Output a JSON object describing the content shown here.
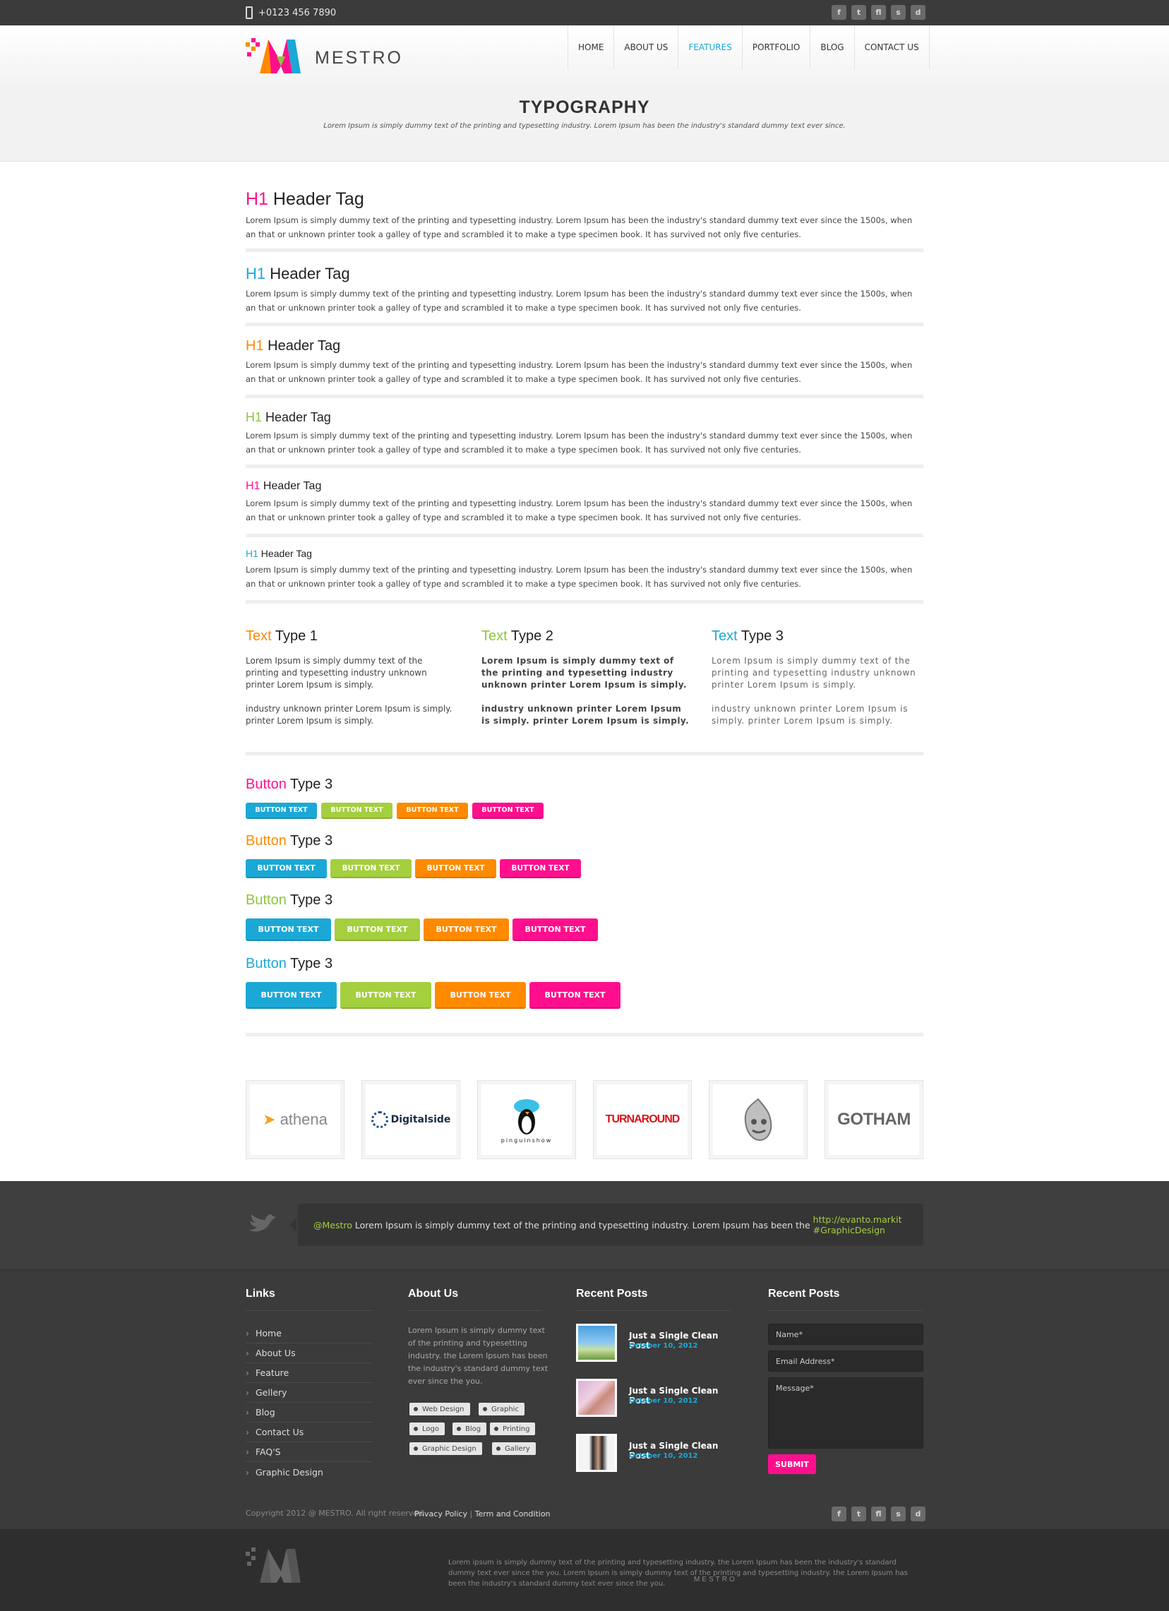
{
  "topbar": {
    "phone": "+0123 456 7890",
    "social": [
      "f",
      "t",
      "fl",
      "s",
      "d"
    ]
  },
  "logo": {
    "text": "MESTRO"
  },
  "nav": [
    "HOME",
    "ABOUT US",
    "FEATURES",
    "PORTFOLIO",
    "BLOG",
    "CONTACT US"
  ],
  "page": {
    "title": "TYPOGRAPHY",
    "subtitle": "Lorem Ipsum is simply dummy text of the printing and typesetting industry. Lorem Ipsum has been the industry's standard dummy text ever since."
  },
  "headers": [
    {
      "tag": "H1",
      "label": "Header Tag",
      "color": "#ff0f8e"
    },
    {
      "tag": "H1",
      "label": "Header Tag",
      "color": "#1ba8d6"
    },
    {
      "tag": "H1",
      "label": "Header Tag",
      "color": "#ff8a00"
    },
    {
      "tag": "H1",
      "label": "Header Tag",
      "color": "#8cc63e"
    },
    {
      "tag": "H1",
      "label": "Header Tag",
      "color": "#ff0f8e"
    },
    {
      "tag": "H1",
      "label": "Header Tag",
      "color": "#1ba8d6"
    }
  ],
  "header_paragraph": "Lorem Ipsum is simply dummy text of the printing and typesetting industry. Lorem Ipsum has been the industry's standard dummy text ever since the 1500s, when an that or unknown printer took a galley of type and scrambled it to make a type specimen book. It has survived not only five centuries.",
  "text_types": [
    {
      "accent": "Text",
      "label": "Type 1",
      "color": "#ff8a00",
      "p1": "Lorem Ipsum is simply dummy text of the printing and typesetting industry unknown printer Lorem Ipsum is simply.",
      "p2": "industry unknown printer Lorem Ipsum is simply. printer Lorem Ipsum is simply."
    },
    {
      "accent": "Text",
      "label": "Type 2",
      "color": "#8cc63e",
      "p1": "Lorem Ipsum is simply dummy text of the printing and typesetting industry unknown printer Lorem Ipsum is simply.",
      "p2": "industry unknown printer Lorem Ipsum is simply. printer Lorem Ipsum is simply."
    },
    {
      "accent": "Text",
      "label": "Type 3",
      "color": "#1ba8d6",
      "p1": "Lorem Ipsum is simply dummy text of the printing and typesetting industry unknown printer Lorem Ipsum is simply.",
      "p2": "industry unknown printer Lorem Ipsum is simply. printer Lorem Ipsum is simply."
    }
  ],
  "button_groups": [
    {
      "accent": "Button",
      "label": "Type 3",
      "color": "#ff0f8e"
    },
    {
      "accent": "Button",
      "label": "Type 3",
      "color": "#ff8a00"
    },
    {
      "accent": "Button",
      "label": "Type 3",
      "color": "#8cc63e"
    },
    {
      "accent": "Button",
      "label": "Type 3",
      "color": "#1ba8d6"
    }
  ],
  "button_text": "BUTTON TEXT",
  "button_colors": [
    "#1ba8d6",
    "#a4cf3e",
    "#ff8a00",
    "#ff0f8e"
  ],
  "partners": [
    "athena",
    "Digitalside",
    "pinguinshow",
    "TURNAROUND",
    "",
    "GOTHAM"
  ],
  "tweet": {
    "handle": "@Mestro",
    "text": " Lorem Ipsum is simply dummy text of the printing and typesetting industry. Lorem Ipsum has been the ",
    "link": "http://evanto.markit #GraphicDesign"
  },
  "footer": {
    "links_title": "Links",
    "links": [
      "Home",
      "About Us",
      "Feature",
      "Gellery",
      "Blog",
      "Contact Us",
      "FAQ'S",
      "Graphic Design"
    ],
    "about_title": "About Us",
    "about_text": "Lorem Ipsum is simply dummy text of the printing and typesetting industry. the Lorem Ipsum has been the industry's standard dummy text ever since the you.",
    "tags": [
      "Web Design",
      "Graphic",
      "Logo",
      "Blog",
      "Printing",
      "Graphic Design",
      "Gallery"
    ],
    "posts_title": "Recent Posts",
    "posts": [
      {
        "title": "Just a Single Clean Post",
        "date": "October 10, 2012"
      },
      {
        "title": "Just a Single Clean Post",
        "date": "October 10, 2012"
      },
      {
        "title": "Just a Single Clean Post",
        "date": "October 10, 2012"
      }
    ],
    "form_title": "Recent Posts",
    "name_ph": "Name*",
    "email_ph": "Email Address*",
    "message_ph": "Message*",
    "submit": "SUBMIT"
  },
  "copyright": "Copyright 2012 @ MESTRO. All right reserved.",
  "privacy": "Privacy Policy",
  "terms": "Term and Condition",
  "bottom_text": "Lorem ipsum is simply dummy text of the printing and typesetting industry. the Lorem Ipsum has been the industry's standard dummy text ever since the you. Lorem Ipsum is simply dummy text of the printing and typesetting industry. the Lorem Ipsum has been the industry's standard dummy text ever since the you."
}
